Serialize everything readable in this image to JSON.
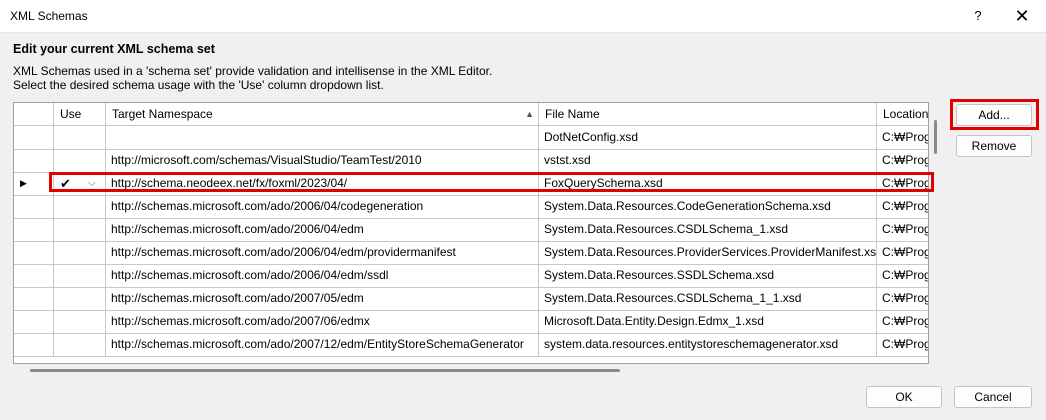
{
  "window": {
    "title": "XML Schemas",
    "help_label": "?",
    "close_label": "✕"
  },
  "heading": "Edit your current XML schema set",
  "description": {
    "line1": "XML Schemas used in a 'schema set' provide validation and intellisense in the XML Editor.",
    "line2": "Select the desired schema usage with the 'Use' column dropdown list."
  },
  "grid": {
    "columns": {
      "use": "Use",
      "namespace": "Target Namespace",
      "file": "File Name",
      "location": "Location"
    },
    "sort_indicator": "▲",
    "rows": [
      {
        "use": "",
        "namespace": "",
        "file": "DotNetConfig.xsd",
        "location": "C:₩Progra"
      },
      {
        "use": "",
        "namespace": "http://microsoft.com/schemas/VisualStudio/TeamTest/2010",
        "file": "vstst.xsd",
        "location": "C:₩Progra"
      },
      {
        "use": "✔",
        "namespace": "http://schema.neodeex.net/fx/foxml/2023/04/",
        "file": "FoxQuerySchema.xsd",
        "location": "C:₩Progra",
        "current": "▶",
        "caret": "⌵"
      },
      {
        "use": "",
        "namespace": "http://schemas.microsoft.com/ado/2006/04/codegeneration",
        "file": "System.Data.Resources.CodeGenerationSchema.xsd",
        "location": "C:₩Progra"
      },
      {
        "use": "",
        "namespace": "http://schemas.microsoft.com/ado/2006/04/edm",
        "file": "System.Data.Resources.CSDLSchema_1.xsd",
        "location": "C:₩Progra"
      },
      {
        "use": "",
        "namespace": "http://schemas.microsoft.com/ado/2006/04/edm/providermanifest",
        "file": "System.Data.Resources.ProviderServices.ProviderManifest.xsd",
        "location": "C:₩Progra"
      },
      {
        "use": "",
        "namespace": "http://schemas.microsoft.com/ado/2006/04/edm/ssdl",
        "file": "System.Data.Resources.SSDLSchema.xsd",
        "location": "C:₩Progra"
      },
      {
        "use": "",
        "namespace": "http://schemas.microsoft.com/ado/2007/05/edm",
        "file": "System.Data.Resources.CSDLSchema_1_1.xsd",
        "location": "C:₩Progra"
      },
      {
        "use": "",
        "namespace": "http://schemas.microsoft.com/ado/2007/06/edmx",
        "file": "Microsoft.Data.Entity.Design.Edmx_1.xsd",
        "location": "C:₩Progra"
      },
      {
        "use": "",
        "namespace": "http://schemas.microsoft.com/ado/2007/12/edm/EntityStoreSchemaGenerator",
        "file": "system.data.resources.entitystoreschemagenerator.xsd",
        "location": "C:₩Progra"
      }
    ]
  },
  "buttons": {
    "add": "Add...",
    "remove": "Remove",
    "ok": "OK",
    "cancel": "Cancel"
  },
  "colors": {
    "highlight": "#e00000"
  }
}
